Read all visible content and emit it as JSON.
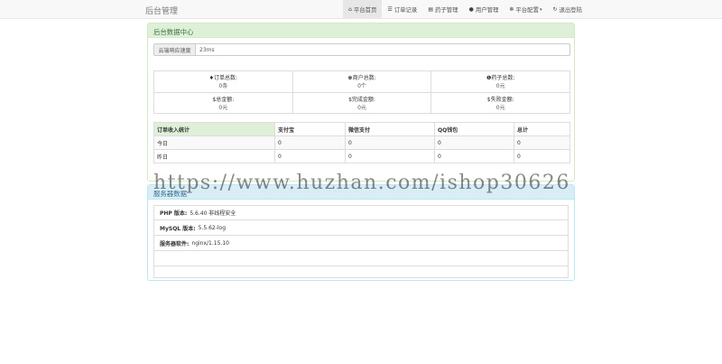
{
  "brand": "后台管理",
  "nav": [
    {
      "label": "平台首页",
      "icon": "home-icon",
      "glyph": "⌂",
      "active": true
    },
    {
      "label": "订单记录",
      "icon": "list-icon",
      "glyph": "☰"
    },
    {
      "label": "药子管理",
      "icon": "card-icon",
      "glyph": "▤"
    },
    {
      "label": "用户管理",
      "icon": "user-icon",
      "glyph": "●"
    },
    {
      "label": "平台配置",
      "icon": "gear-icon",
      "glyph": "✻",
      "dropdown": true
    },
    {
      "label": "退出登陆",
      "icon": "logout-icon",
      "glyph": "↻"
    }
  ],
  "data_center": {
    "title": "后台数据中心",
    "speed_label": "云端响应速度",
    "speed_value": "23ms",
    "stats": [
      {
        "label": "订单总数:",
        "value": "0条",
        "icon": "drop-icon",
        "glyph": "♦"
      },
      {
        "label": "商户总数:",
        "value": "0个",
        "icon": "users-icon",
        "glyph": "♚"
      },
      {
        "label": "药子总数:",
        "value": "0元",
        "icon": "info-icon",
        "glyph": "❶"
      },
      {
        "label": "总金额:",
        "value": "0元",
        "icon": "dollar-icon",
        "glyph": "$"
      },
      {
        "label": "完成金额:",
        "value": "0元",
        "icon": "dollar-icon",
        "glyph": "$"
      },
      {
        "label": "失败金额:",
        "value": "0元",
        "icon": "dollar-icon",
        "glyph": "$"
      }
    ],
    "table": {
      "headers": [
        "订单收入统计",
        "支付宝",
        "微信支付",
        "QQ钱包",
        "总计"
      ],
      "rows": [
        [
          "今日",
          "0",
          "0",
          "0",
          "0"
        ],
        [
          "昨日",
          "0",
          "0",
          "0",
          "0"
        ]
      ]
    }
  },
  "system": {
    "title": "服务器数据",
    "items": [
      {
        "key": "PHP 版本:",
        "value": "5.6.40 非线程安全"
      },
      {
        "key": "MySQL 版本:",
        "value": "5.5.62-log"
      },
      {
        "key": "服务器软件:",
        "value": "nginx/1.15.10"
      }
    ]
  },
  "watermark": "https://www.huzhan.com/ishop30626"
}
